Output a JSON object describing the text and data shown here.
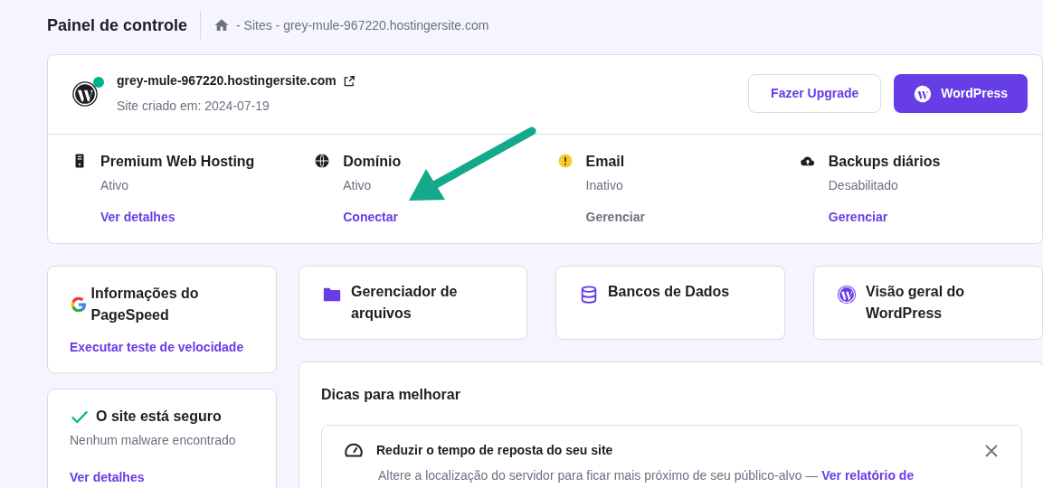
{
  "header": {
    "title": "Painel de controle",
    "breadcrumb": "- Sites - grey-mule-967220.hostingersite.com"
  },
  "site": {
    "domain": "grey-mule-967220.hostingersite.com",
    "created": "Site criado em: 2024-07-19",
    "online": true,
    "buttons": [
      {
        "label": "Fazer Upgrade",
        "kind": "outline"
      },
      {
        "label": "WordPress",
        "kind": "primary"
      }
    ]
  },
  "services": [
    {
      "kind": "server",
      "title": "Premium Web Hosting",
      "status": "Ativo",
      "action": "Ver detalhes",
      "disabled": false
    },
    {
      "kind": "www",
      "title": "Domínio",
      "status": "Ativo",
      "action": "Conectar",
      "disabled": false
    },
    {
      "kind": "warning",
      "title": "Email",
      "status": "Inativo",
      "action": "Gerenciar",
      "disabled": true
    },
    {
      "kind": "cloud",
      "title": "Backups diários",
      "status": "Desabilitado",
      "action": "Gerenciar",
      "disabled": false
    }
  ],
  "pagespeed": {
    "title": "Informações do PageSpeed",
    "link": "Executar teste de velocidade"
  },
  "tiles": [
    {
      "kind": "folder",
      "title": "Gerenciador de arquivos"
    },
    {
      "kind": "database",
      "title": "Bancos de Dados"
    },
    {
      "kind": "wordpress",
      "title": "Visão geral do WordPress"
    }
  ],
  "security": {
    "title": "O site está seguro",
    "text": "Nenhum malware encontrado",
    "link": "Ver detalhes"
  },
  "tips": {
    "title": "Dicas para melhorar",
    "items": [
      {
        "title": "Reduzir o tempo de reposta do seu site",
        "text": "Altere a localização do servidor para ficar mais próximo de seu público-alvo — ",
        "link": "Ver relatório de"
      }
    ]
  }
}
